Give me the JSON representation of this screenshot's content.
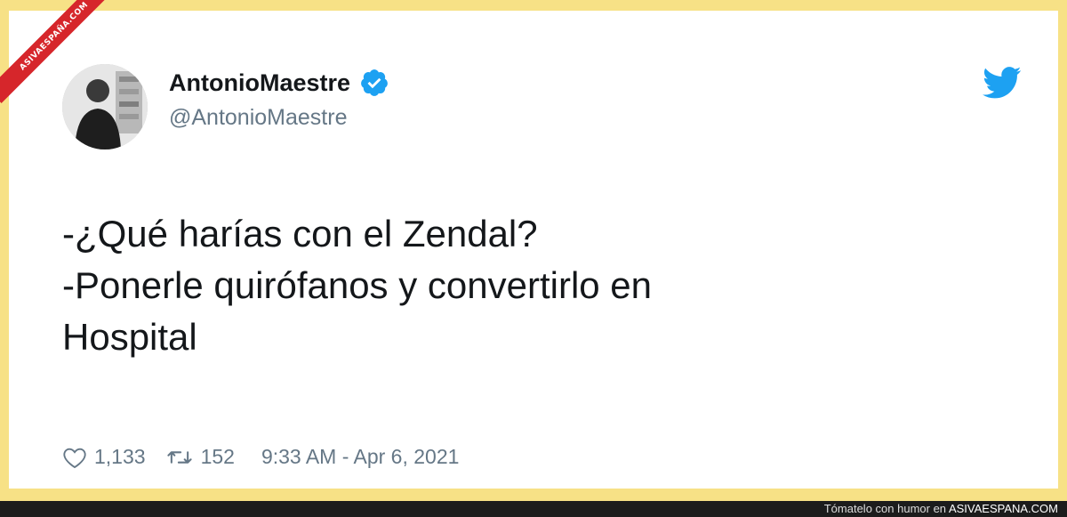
{
  "watermark": {
    "ribbon": "ASIVAESPAÑA.COM"
  },
  "tweet": {
    "name": "AntonioMaestre",
    "handle": "@AntonioMaestre",
    "text_lines": [
      "-¿Qué harías con el Zendal?",
      "-Ponerle quirófanos y convertirlo en",
      "Hospital"
    ],
    "likes": "1,133",
    "retweets": "152",
    "timestamp": "9:33 AM - Apr 6, 2021"
  },
  "footer_bar": {
    "prefix": "Tómatelo con humor en",
    "brand": "ASIVAESPANA.COM"
  },
  "colors": {
    "frame": "#f7e186",
    "twitter_blue": "#1da1f2",
    "verified_blue": "#1da1f2",
    "ribbon_red": "#d6262b",
    "bar_bg": "#1c1c1c"
  },
  "icons": [
    "verified-badge-icon",
    "twitter-bird-icon",
    "heart-icon",
    "retweet-icon"
  ]
}
